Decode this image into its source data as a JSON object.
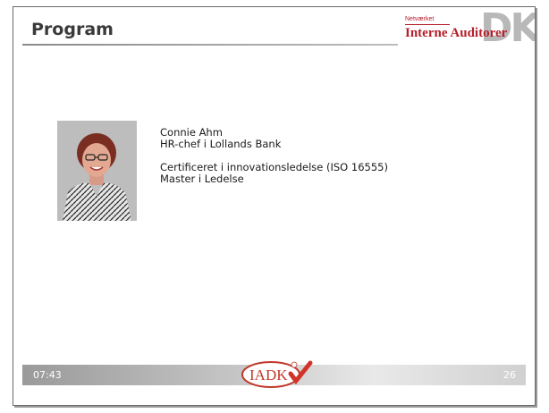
{
  "header": {
    "title": "Program"
  },
  "logo": {
    "small_text": "Netværket",
    "name": "Interne Auditorer",
    "mark": "DK",
    "color": "#b51f2a"
  },
  "bio": {
    "name": "Connie Ahm",
    "role": "HR-chef i Lollands Bank",
    "credential_1": "Certificeret i innovationsledelse (ISO 16555)",
    "credential_2": "Master i Ledelse"
  },
  "footer": {
    "time": "07:43",
    "page_number": "26",
    "logo_text": "IADK"
  }
}
